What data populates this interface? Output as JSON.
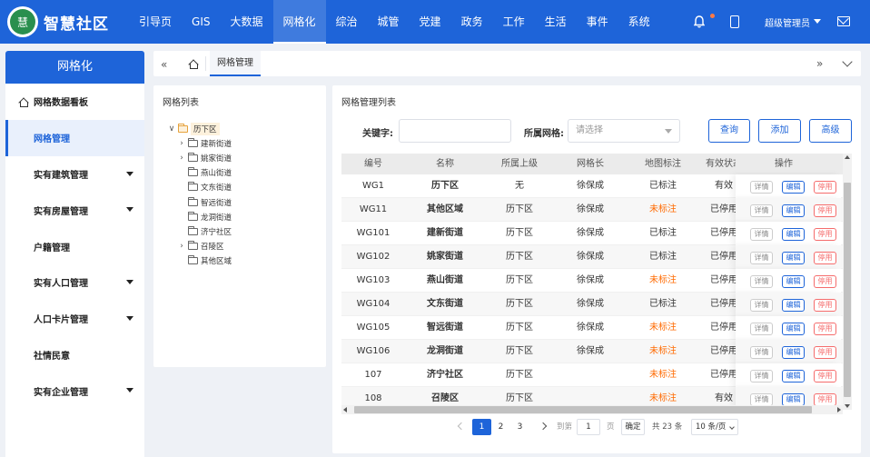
{
  "app": {
    "title": "智慧社区",
    "logo_text": "慧",
    "colors": {
      "primary": "#1e64d9",
      "unmarked": "#ff6a00",
      "danger": "#f56c6c"
    }
  },
  "nav": {
    "items": [
      "引导页",
      "GIS",
      "大数据",
      "网格化",
      "综治",
      "城管",
      "党建",
      "政务",
      "工作",
      "生活",
      "事件",
      "系统"
    ],
    "active": "网格化"
  },
  "user": {
    "name": "超级管理员"
  },
  "sidebar": {
    "title": "网格化",
    "items": [
      {
        "label": "网格数据看板",
        "has_caret": false,
        "icon": "home-icon"
      },
      {
        "label": "网格管理",
        "has_caret": false,
        "active": true
      },
      {
        "label": "实有建筑管理",
        "has_caret": true
      },
      {
        "label": "实有房屋管理",
        "has_caret": true
      },
      {
        "label": "户籍管理",
        "has_caret": false
      },
      {
        "label": "实有人口管理",
        "has_caret": true
      },
      {
        "label": "人口卡片管理",
        "has_caret": true
      },
      {
        "label": "社情民意",
        "has_caret": false
      },
      {
        "label": "实有企业管理",
        "has_caret": true
      }
    ]
  },
  "tabs": {
    "active": "网格管理"
  },
  "tree_panel": {
    "title": "网格列表",
    "root": "历下区",
    "nodes": [
      {
        "label": "建新街道",
        "expandable": true
      },
      {
        "label": "姚家街道",
        "expandable": true
      },
      {
        "label": "燕山街道",
        "expandable": false
      },
      {
        "label": "文东街道",
        "expandable": false
      },
      {
        "label": "智远街道",
        "expandable": false
      },
      {
        "label": "龙洞街道",
        "expandable": false
      },
      {
        "label": "济宁社区",
        "expandable": false
      },
      {
        "label": "召陵区",
        "expandable": true
      },
      {
        "label": "其他区域",
        "expandable": false
      }
    ]
  },
  "main": {
    "title": "网格管理列表",
    "search": {
      "keyword_label": "关键字:",
      "keyword_value": "",
      "grid_label": "所属网格:",
      "grid_placeholder": "请选择"
    },
    "buttons": {
      "query": "查询",
      "add": "添加",
      "advanced": "高级"
    },
    "columns": [
      "编号",
      "名称",
      "所属上级",
      "网格长",
      "地图标注",
      "有效状态",
      "操作"
    ],
    "op_labels": {
      "detail": "详情",
      "edit": "编辑",
      "disable": "停用"
    },
    "rows": [
      {
        "id": "WG1",
        "name": "历下区",
        "parent": "无",
        "leader": "徐保成",
        "map": "已标注",
        "status": "有效"
      },
      {
        "id": "WG11",
        "name": "其他区域",
        "parent": "历下区",
        "leader": "徐保成",
        "map": "未标注",
        "status": "已停用"
      },
      {
        "id": "WG101",
        "name": "建新街道",
        "parent": "历下区",
        "leader": "徐保成",
        "map": "已标注",
        "status": "已停用"
      },
      {
        "id": "WG102",
        "name": "姚家街道",
        "parent": "历下区",
        "leader": "徐保成",
        "map": "已标注",
        "status": "已停用"
      },
      {
        "id": "WG103",
        "name": "燕山街道",
        "parent": "历下区",
        "leader": "徐保成",
        "map": "未标注",
        "status": "已停用"
      },
      {
        "id": "WG104",
        "name": "文东街道",
        "parent": "历下区",
        "leader": "徐保成",
        "map": "已标注",
        "status": "已停用"
      },
      {
        "id": "WG105",
        "name": "智远街道",
        "parent": "历下区",
        "leader": "徐保成",
        "map": "未标注",
        "status": "已停用"
      },
      {
        "id": "WG106",
        "name": "龙洞街道",
        "parent": "历下区",
        "leader": "徐保成",
        "map": "未标注",
        "status": "已停用"
      },
      {
        "id": "107",
        "name": "济宁社区",
        "parent": "历下区",
        "leader": "",
        "map": "未标注",
        "status": "已停用"
      },
      {
        "id": "108",
        "name": "召陵区",
        "parent": "历下区",
        "leader": "",
        "map": "未标注",
        "status": "有效"
      }
    ],
    "pagination": {
      "pages": [
        "1",
        "2",
        "3"
      ],
      "current": "1",
      "goto_label": "到第",
      "goto_value": "1",
      "page_unit": "页",
      "confirm": "确定",
      "total": "共 23 条",
      "page_size": "10 条/页"
    }
  }
}
